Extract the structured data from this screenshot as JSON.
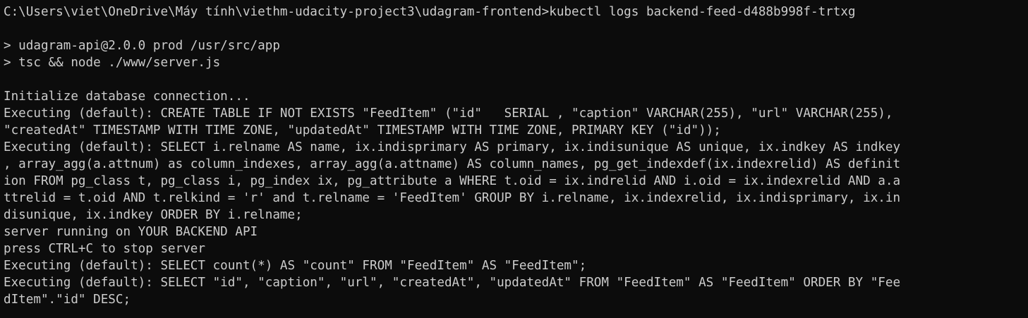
{
  "terminal": {
    "lines": [
      "C:\\Users\\viet\\OneDrive\\Máy tính\\viethm-udacity-project3\\udagram-frontend>kubectl logs backend-feed-d488b998f-trtxg",
      "",
      "> udagram-api@2.0.0 prod /usr/src/app",
      "> tsc && node ./www/server.js",
      "",
      "Initialize database connection...",
      "Executing (default): CREATE TABLE IF NOT EXISTS \"FeedItem\" (\"id\"   SERIAL , \"caption\" VARCHAR(255), \"url\" VARCHAR(255),",
      "\"createdAt\" TIMESTAMP WITH TIME ZONE, \"updatedAt\" TIMESTAMP WITH TIME ZONE, PRIMARY KEY (\"id\"));",
      "Executing (default): SELECT i.relname AS name, ix.indisprimary AS primary, ix.indisunique AS unique, ix.indkey AS indkey",
      ", array_agg(a.attnum) as column_indexes, array_agg(a.attname) AS column_names, pg_get_indexdef(ix.indexrelid) AS definit",
      "ion FROM pg_class t, pg_class i, pg_index ix, pg_attribute a WHERE t.oid = ix.indrelid AND i.oid = ix.indexrelid AND a.a",
      "ttrelid = t.oid AND t.relkind = 'r' and t.relname = 'FeedItem' GROUP BY i.relname, ix.indexrelid, ix.indisprimary, ix.in",
      "disunique, ix.indkey ORDER BY i.relname;",
      "server running on YOUR BACKEND API",
      "press CTRL+C to stop server",
      "Executing (default): SELECT count(*) AS \"count\" FROM \"FeedItem\" AS \"FeedItem\";",
      "Executing (default): SELECT \"id\", \"caption\", \"url\", \"createdAt\", \"updatedAt\" FROM \"FeedItem\" AS \"FeedItem\" ORDER BY \"Fee",
      "dItem\".\"id\" DESC;"
    ],
    "colors": {
      "background": "#0c0c0c",
      "foreground": "#cccccc"
    }
  }
}
